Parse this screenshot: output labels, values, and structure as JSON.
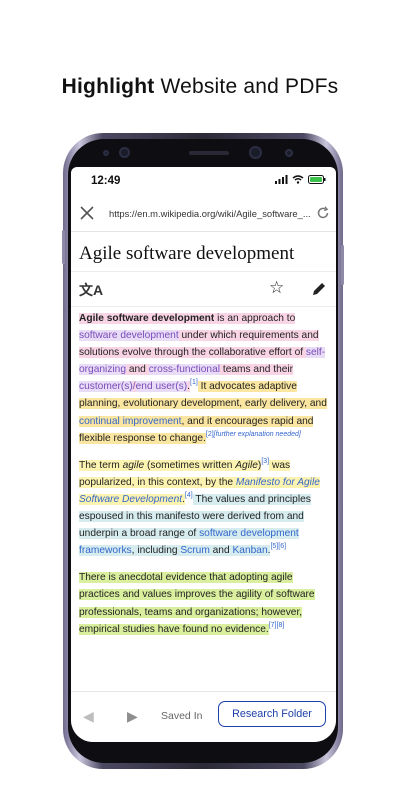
{
  "headline": {
    "bold": "Highlight",
    "rest": " Website and PDFs"
  },
  "status": {
    "time": "12:49"
  },
  "browser": {
    "url": "https://en.m.wikipedia.org/wiki/Agile_software_..."
  },
  "article": {
    "title": "Agile software development",
    "p1": {
      "a1": "Agile software development",
      "a2": " is an approach to ",
      "a3": "software development",
      "a4": " under which requirements and solutions evolve through the collaborative effort of ",
      "a5": "self-organizing",
      "a6": " and ",
      "a7": "cross-functional",
      "a8": " teams and their ",
      "a9": "customer(s)",
      "a10": "/",
      "a11": "end user(s)",
      "a12": ".",
      "ref1": "[1]",
      "b1": " It advocates adaptive planning, evolutionary development, early delivery, and ",
      "b2": "continual improvement",
      "b3": ", and it encourages rapid and flexible response to change.",
      "ref2": "[2]",
      "note": "[further explanation needed]"
    },
    "p2": {
      "a1": "The term ",
      "a2": "agile",
      "a3": " (sometimes written ",
      "a4": "Agile",
      "a5": ")",
      "ref3": "[3]",
      "a6": " was popularized, in this context, by the ",
      "a7": "Manifesto for Agile Software Development",
      "a8": ".",
      "ref4": "[4]",
      "b1": " The values and principles espoused in this manifesto were derived from and underpin a broad range of ",
      "b2": "software development frameworks",
      "b3": ", including ",
      "b4": "Scrum",
      "b5": " and ",
      "b6": "Kanban",
      "b7": ".",
      "ref5": "[5]",
      "ref6": "[6]"
    },
    "p3": {
      "a1": "There is anecdotal evidence that adopting agile practices and values improves the agility of software professionals, teams and organizations; however, empirical studies have found no evidence.",
      "ref7": "[7]",
      "ref8": "[8]"
    }
  },
  "bottombar": {
    "back": "◀",
    "forward": "▶",
    "saved_label": "Saved In",
    "folder_label": "Research Folder"
  }
}
